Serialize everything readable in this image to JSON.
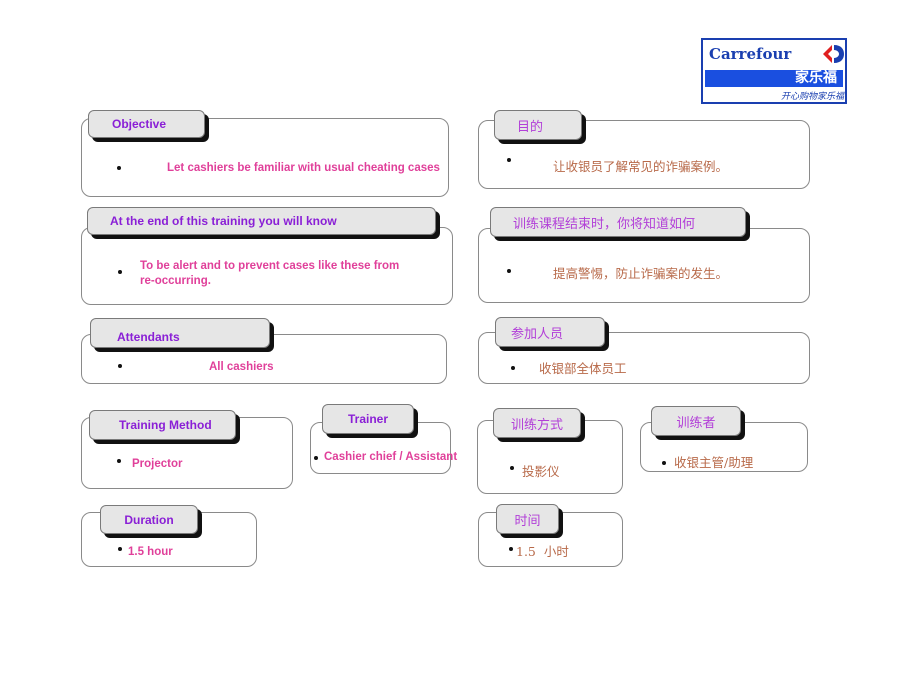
{
  "logo": {
    "brand": "Carrefour",
    "chinese_name": "家乐福",
    "slogan": "开心购物家乐福",
    "colors": {
      "blue": "#1a3fb0",
      "red": "#e02020"
    }
  },
  "english": {
    "objective": {
      "title": "Objective",
      "text": "Let  cashiers be familiar with usual cheating cases"
    },
    "outcome": {
      "title": "At the end of this training you will know",
      "text": "To be alert and to prevent cases like these from re-occurring."
    },
    "attendants": {
      "title": "Attendants",
      "text": "All cashiers"
    },
    "method": {
      "title": "Training Method",
      "text": "Projector"
    },
    "trainer": {
      "title": "Trainer",
      "text": "Cashier chief / Assistant"
    },
    "duration": {
      "title": "Duration",
      "text": "1.5 hour"
    }
  },
  "chinese": {
    "objective": {
      "title": "目的",
      "text": "让收银员了解常见的诈骗案例。"
    },
    "outcome": {
      "title": "训练课程结束时，你将知道如何",
      "text": "提高警惕，防止诈骗案的发生。"
    },
    "attendants": {
      "title": "参加人员",
      "text": "收银部全体员工"
    },
    "method": {
      "title": "训练方式",
      "text": "投影仪"
    },
    "trainer": {
      "title": "训练者",
      "text": "收银主管/助理"
    },
    "duration": {
      "title": "时间",
      "text": "1.5  小时"
    }
  }
}
